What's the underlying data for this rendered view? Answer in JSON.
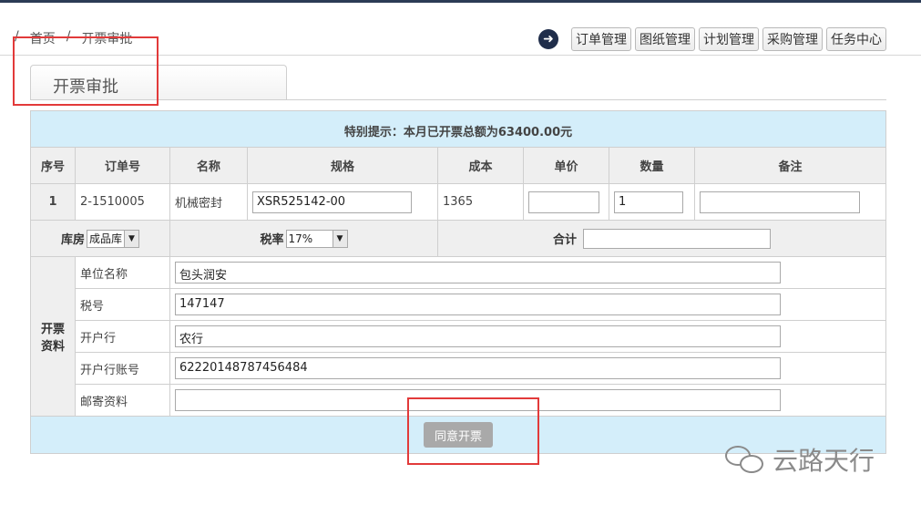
{
  "breadcrumb": {
    "sep1": "/",
    "home": "首页",
    "sep2": "/",
    "current": "开票审批"
  },
  "nav": {
    "arrow_icon": "arrow-right-icon",
    "items": [
      "订单管理",
      "图纸管理",
      "计划管理",
      "采购管理",
      "任务中心"
    ]
  },
  "tab": {
    "title": "开票审批"
  },
  "notice": "特别提示：本月已开票总额为63400.00元",
  "table": {
    "headers": [
      "序号",
      "订单号",
      "名称",
      "规格",
      "成本",
      "单价",
      "数量",
      "备注"
    ],
    "row": {
      "index": "1",
      "order_no": "2-1510005",
      "name": "机械密封",
      "spec": "XSR525142-00",
      "cost": "1365",
      "unit_price": "",
      "quantity": "1",
      "remark": ""
    }
  },
  "options": {
    "warehouse_label": "库房",
    "warehouse_value": "成品库",
    "tax_label": "税率",
    "tax_value": "17%",
    "total_label": "合计",
    "total_value": ""
  },
  "invoice": {
    "section_label": "开票\n资料",
    "section_label_1": "开票",
    "section_label_2": "资料",
    "fields": [
      {
        "label": "单位名称",
        "value": "包头润安"
      },
      {
        "label": "税号",
        "value": "147147"
      },
      {
        "label": "开户行",
        "value": "农行"
      },
      {
        "label": "开户行账号",
        "value": "62220148787456484"
      },
      {
        "label": "邮寄资料",
        "value": ""
      }
    ]
  },
  "actions": {
    "agree": "同意开票"
  },
  "watermark": "云路天行",
  "colors": {
    "notice_bg": "#d4eefa",
    "highlight_border": "#e23a3a",
    "button_grey": "#a9a9a9"
  }
}
